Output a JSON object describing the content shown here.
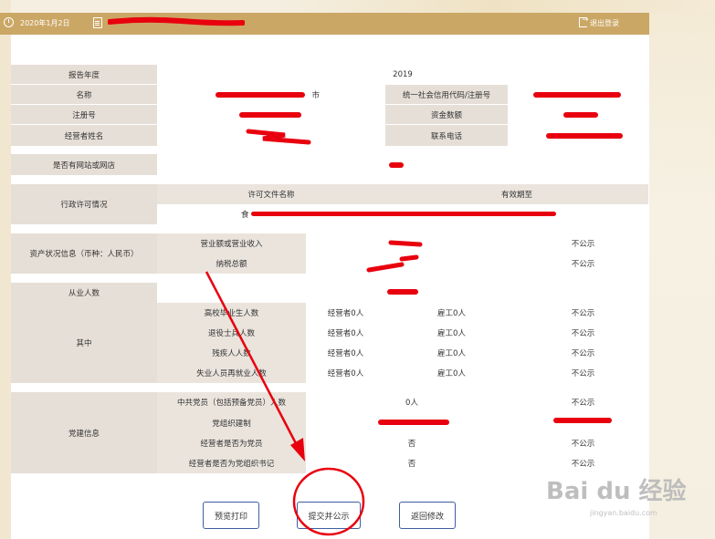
{
  "header": {
    "date": "2020年1月2日",
    "logout": "退出登录"
  },
  "report_table": {
    "year_label": "报告年度",
    "year_value": "2019",
    "name_label": "名称",
    "name_value_visible": "市",
    "credit_code_label": "统一社会信用代码/注册号",
    "reg_no_label": "注册号",
    "capital_label": "资金数额",
    "operator_label": "经营者姓名",
    "phone_label": "联系电话",
    "website_label": "是否有网站或网店",
    "license_label": "行政许可情况",
    "license_col1": "许可文件名称",
    "license_col2": "有效期至",
    "license_name_visible": "食",
    "assets_label": "资产状况信息（币种：人民币）",
    "revenue_label": "营业额或营业收入",
    "tax_label": "纳税总额",
    "not_public": "不公示",
    "employees_label": "从业人数",
    "of_which_label": "其中",
    "employee_rows": [
      {
        "label": "高校毕业生人数",
        "operator": "经营者0人",
        "staff": "雇工0人",
        "pub": "不公示"
      },
      {
        "label": "退役士兵人数",
        "operator": "经营者0人",
        "staff": "雇工0人",
        "pub": "不公示"
      },
      {
        "label": "残疾人人数",
        "operator": "经营者0人",
        "staff": "雇工0人",
        "pub": "不公示"
      },
      {
        "label": "失业人员再就业人数",
        "operator": "经营者0人",
        "staff": "雇工0人",
        "pub": "不公示"
      }
    ],
    "party_label": "党建信息",
    "party_rows": [
      {
        "label": "中共党员（包括预备党员）人数",
        "value": "0人",
        "pub": "不公示"
      },
      {
        "label": "党组织建制",
        "value": "",
        "pub": ""
      },
      {
        "label": "经营者是否为党员",
        "value": "否",
        "pub": "不公示"
      },
      {
        "label": "经营者是否为党组织书记",
        "value": "否",
        "pub": "不公示"
      }
    ]
  },
  "buttons": {
    "preview": "预览打印",
    "submit": "提交并公示",
    "back": "返回修改"
  },
  "watermark": {
    "main": "Bai du 经验",
    "sub": "jingyan.baidu.com"
  },
  "colors": {
    "header": "#cba765",
    "label_bg": "#e6dfd7",
    "annotation": "#e8000e",
    "button_border": "#3d5fa0"
  }
}
